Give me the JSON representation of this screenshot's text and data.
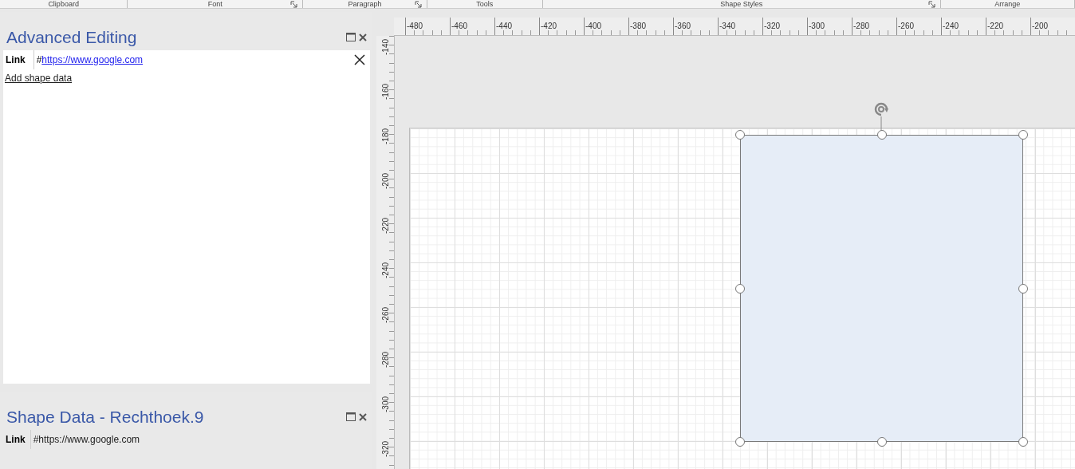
{
  "ribbon": {
    "groups": [
      {
        "label": "Clipboard",
        "launcher": false
      },
      {
        "label": "Font",
        "launcher": true
      },
      {
        "label": "Paragraph",
        "launcher": true
      },
      {
        "label": "Tools",
        "launcher": false
      },
      {
        "label": "Shape Styles",
        "launcher": true
      },
      {
        "label": "Arrange",
        "launcher": false
      }
    ]
  },
  "advanced_editing": {
    "title": "Advanced Editing",
    "rows": [
      {
        "label": "Link",
        "prefix": "#",
        "link": "https://www.google.com"
      }
    ],
    "add_link": "Add shape data"
  },
  "shape_data": {
    "title": "Shape Data - Rechthoek.9",
    "rows": [
      {
        "label": "Link",
        "value": "#https://www.google.com"
      }
    ]
  },
  "ruler": {
    "horizontal": [
      "-480",
      "-460",
      "-440",
      "-420",
      "-400",
      "-380",
      "-360",
      "-340",
      "-320",
      "-300",
      "-280",
      "-260",
      "-240",
      "-220",
      "-200"
    ],
    "vertical": [
      "-140",
      "-160",
      "-180",
      "-200",
      "-220",
      "-240",
      "-260",
      "-280",
      "-300",
      "-320"
    ]
  },
  "shape": {
    "selected": true
  }
}
